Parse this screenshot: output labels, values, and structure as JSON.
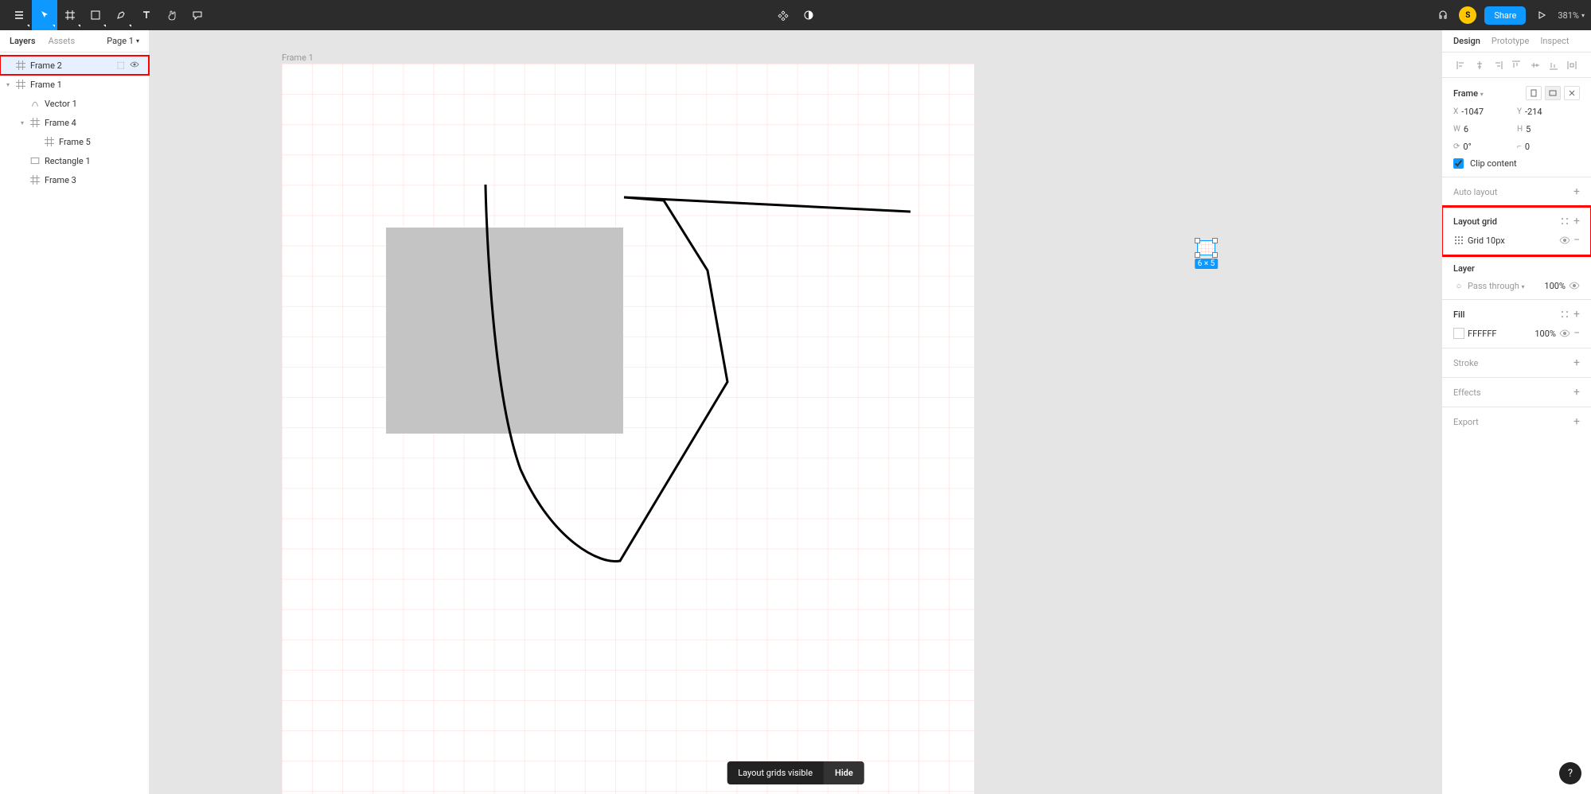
{
  "toolbar": {
    "menu_icon": "figma-menu",
    "tools": [
      "move",
      "frame",
      "shape",
      "pen",
      "text",
      "hand",
      "comment"
    ],
    "active_tool": "move",
    "avatar_letter": "S",
    "share_label": "Share",
    "zoom": "381%"
  },
  "left": {
    "tabs": {
      "layers": "Layers",
      "assets": "Assets"
    },
    "active_tab": "layers",
    "page": "Page 1",
    "layers": [
      {
        "name": "Frame 2",
        "icon": "frame",
        "indent": 0,
        "selected": true,
        "highlighted": true,
        "locked": false,
        "visible": true,
        "show_actions": true
      },
      {
        "name": "Frame 1",
        "icon": "frame",
        "indent": 0,
        "expandable": true
      },
      {
        "name": "Vector 1",
        "icon": "vector",
        "indent": 1
      },
      {
        "name": "Frame 4",
        "icon": "frame",
        "indent": 1,
        "expandable": true
      },
      {
        "name": "Frame 5",
        "icon": "frame",
        "indent": 2
      },
      {
        "name": "Rectangle 1",
        "icon": "rectangle",
        "indent": 1
      },
      {
        "name": "Frame 3",
        "icon": "frame",
        "indent": 1
      }
    ]
  },
  "canvas": {
    "frame1_label": "Frame 1",
    "selected_dim": "6 × 5"
  },
  "right": {
    "tabs": {
      "design": "Design",
      "prototype": "Prototype",
      "inspect": "Inspect"
    },
    "active_tab": "design",
    "frame": {
      "title": "Frame",
      "x": "-1047",
      "y": "-214",
      "w": "6",
      "h": "5",
      "rotation": "0°",
      "radius": "0",
      "clip_content": "Clip content",
      "clip_checked": true
    },
    "auto_layout": "Auto layout",
    "layout_grid": {
      "title": "Layout grid",
      "item": "Grid 10px"
    },
    "layer": {
      "title": "Layer",
      "blend": "Pass through",
      "opacity": "100%"
    },
    "fill": {
      "title": "Fill",
      "hex": "FFFFFF",
      "opacity": "100%"
    },
    "stroke": "Stroke",
    "effects": "Effects",
    "export": "Export"
  },
  "toast": {
    "text": "Layout grids visible",
    "action": "Hide"
  },
  "help": "?"
}
